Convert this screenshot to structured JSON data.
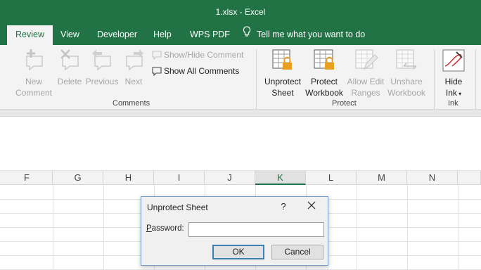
{
  "window": {
    "title": "1.xlsx  -  Excel"
  },
  "tabs": [
    {
      "label": "Review",
      "active": true
    },
    {
      "label": "View"
    },
    {
      "label": "Developer"
    },
    {
      "label": "Help"
    },
    {
      "label": "WPS PDF"
    }
  ],
  "tell_me": {
    "label": "Tell me what you want to do"
  },
  "ribbon": {
    "comments": {
      "group_label": "Comments",
      "new_comment": "New\nComment",
      "delete": "Delete",
      "previous": "Previous",
      "next": "Next",
      "show_hide_comment": "Show/Hide Comment",
      "show_all_comments": "Show All Comments"
    },
    "protect": {
      "group_label": "Protect",
      "unprotect_sheet": "Unprotect\nSheet",
      "protect_workbook": "Protect\nWorkbook",
      "allow_edit_ranges": "Allow Edit\nRanges",
      "unshare_workbook": "Unshare\nWorkbook"
    },
    "ink": {
      "group_label": "Ink",
      "hide_ink": "Hide",
      "hide_ink_2": "Ink"
    }
  },
  "columns": [
    "F",
    "G",
    "H",
    "I",
    "J",
    "K",
    "L",
    "M",
    "N"
  ],
  "selected_column": "K",
  "dialog": {
    "title": "Unprotect Sheet",
    "help": "?",
    "password_label_prefix": "P",
    "password_label_rest": "assword:",
    "password_value": "",
    "ok": "OK",
    "cancel": "Cancel"
  },
  "colors": {
    "accent": "#217346",
    "disabled": "#a6a6a6",
    "lock": "#e8a020"
  }
}
